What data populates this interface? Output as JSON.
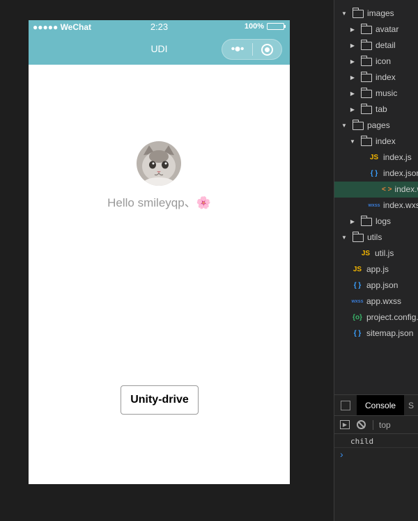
{
  "statusbar": {
    "signal": "●●●●● WeChat",
    "time": "2:23",
    "battery": "100%"
  },
  "navbar": {
    "title": "UDI",
    "more_icon": "•●•"
  },
  "main": {
    "greeting": "Hello smileyqp、",
    "flower": "🌸",
    "button_label": "Unity-drive"
  },
  "tree": [
    {
      "label": "images",
      "type": "folder",
      "open": true,
      "depth": 0
    },
    {
      "label": "avatar",
      "type": "folder",
      "open": false,
      "depth": 1
    },
    {
      "label": "detail",
      "type": "folder",
      "open": false,
      "depth": 1
    },
    {
      "label": "icon",
      "type": "folder",
      "open": false,
      "depth": 1
    },
    {
      "label": "index",
      "type": "folder",
      "open": false,
      "depth": 1
    },
    {
      "label": "music",
      "type": "folder",
      "open": false,
      "depth": 1
    },
    {
      "label": "tab",
      "type": "folder",
      "open": false,
      "depth": 1
    },
    {
      "label": "pages",
      "type": "folder",
      "open": true,
      "depth": 0
    },
    {
      "label": "index",
      "type": "folder",
      "open": true,
      "depth": 1
    },
    {
      "label": "index.js",
      "type": "js",
      "depth": 2
    },
    {
      "label": "index.json",
      "type": "json",
      "depth": 2
    },
    {
      "label": "index.wxml",
      "type": "wxml",
      "depth": 2,
      "selected": true
    },
    {
      "label": "index.wxss",
      "type": "wxss",
      "depth": 2
    },
    {
      "label": "logs",
      "type": "folder",
      "open": false,
      "depth": 1
    },
    {
      "label": "utils",
      "type": "folder",
      "open": true,
      "depth": 0
    },
    {
      "label": "util.js",
      "type": "js",
      "depth": 1
    },
    {
      "label": "app.js",
      "type": "js",
      "depth": 0
    },
    {
      "label": "app.json",
      "type": "json",
      "depth": 0
    },
    {
      "label": "app.wxss",
      "type": "wxss",
      "depth": 0
    },
    {
      "label": "project.config.json",
      "type": "cfg",
      "depth": 0
    },
    {
      "label": "sitemap.json",
      "type": "json",
      "depth": 0
    }
  ],
  "console": {
    "tab_label": "Console",
    "next_tab": "S",
    "context": "top",
    "log": "child",
    "prompt": "›"
  },
  "colors": {
    "navbar": "#6dbcc7",
    "selected": "#26503f"
  }
}
